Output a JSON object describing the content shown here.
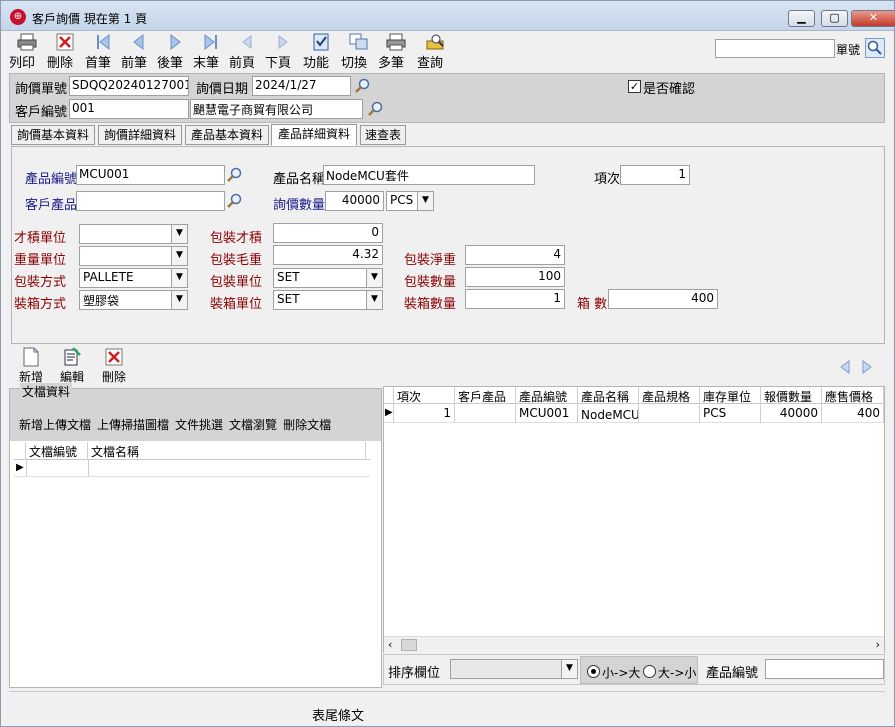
{
  "window": {
    "title": "客戶詢價  現在第 1 頁"
  },
  "toolbar": {
    "buttons": [
      "列印",
      "刪除",
      "首筆",
      "前筆",
      "後筆",
      "末筆",
      "前頁",
      "下頁",
      "功能",
      "切換",
      "多筆",
      "查詢"
    ],
    "search_label": "單號",
    "search_value": ""
  },
  "header": {
    "inquiry_no_label": "詢價單號",
    "inquiry_no": "SDQQ20240127001",
    "inquiry_date_label": "詢價日期",
    "inquiry_date": "2024/1/27",
    "confirmed_label": "是否確認",
    "confirmed": true,
    "customer_no_label": "客戶編號",
    "customer_no": "001",
    "customer_name": "颶慧電子商貿有限公司"
  },
  "tabs": [
    "詢價基本資料",
    "詢價詳細資料",
    "產品基本資料",
    "產品詳細資料",
    "速查表"
  ],
  "active_tab": 3,
  "detail": {
    "product_no_label": "產品編號",
    "product_no": "MCU001",
    "product_name_label": "產品名稱",
    "product_name": "NodeMCU套件",
    "item_label": "項次",
    "item": "1",
    "customer_product_label": "客戶產品",
    "customer_product": "",
    "quantity_label": "詢價數量",
    "quantity": "40000",
    "unit": "PCS",
    "cbm_unit_label": "才積單位",
    "cbm_unit": "",
    "pack_cbm_label": "包裝才積",
    "pack_cbm": "0",
    "weight_unit_label": "重量單位",
    "weight_unit": "",
    "gross_weight_label": "包裝毛重",
    "gross_weight": "4.32",
    "net_weight_label": "包裝淨重",
    "net_weight": "4",
    "pack_method_label": "包裝方式",
    "pack_method": "PALLETE",
    "pack_unit_label": "包裝單位",
    "pack_unit": "SET",
    "pack_qty_label": "包裝數量",
    "pack_qty": "100",
    "box_method_label": "裝箱方式",
    "box_method": "塑膠袋",
    "box_unit_label": "裝箱單位",
    "box_unit": "SET",
    "box_qty_label": "裝箱數量",
    "box_qty": "1",
    "box_count_label": "箱 數",
    "box_count": "400"
  },
  "doc_toolbar": [
    "新增",
    "編輯",
    "刪除"
  ],
  "documents": {
    "title": "文檔資料",
    "actions": [
      "新增上傳文檔",
      "上傳掃描圖檔",
      "文件挑選",
      "文檔瀏覽",
      "刪除文檔"
    ],
    "columns": [
      "文檔編號",
      "文檔名稱"
    ]
  },
  "grid": {
    "columns": [
      "項次",
      "客戶產品",
      "產品編號",
      "產品名稱",
      "產品規格",
      "庫存單位",
      "報價數量",
      "應售價格"
    ],
    "rows": [
      [
        "1",
        "",
        "MCU001",
        "NodeMCU套",
        "",
        "PCS",
        "40000",
        "400"
      ]
    ]
  },
  "sort": {
    "label": "排序欄位",
    "value": "",
    "asc_label": "小->大",
    "desc_label": "大->小",
    "asc_selected": true,
    "search_label": "產品編號",
    "search_value": ""
  },
  "footer": {
    "text": "表尾條文"
  }
}
